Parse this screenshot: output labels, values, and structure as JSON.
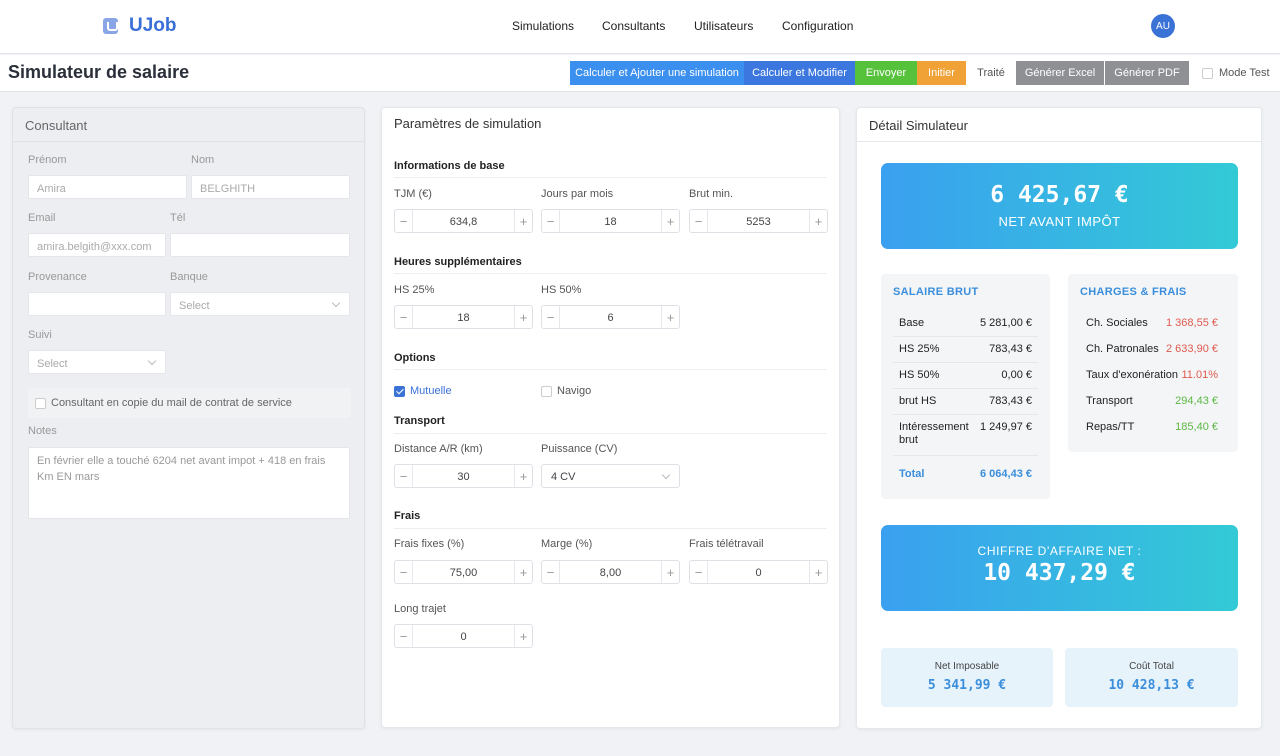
{
  "app": {
    "name": "UJob"
  },
  "nav": {
    "items": [
      "Simulations",
      "Consultants",
      "Utilisateurs",
      "Configuration"
    ],
    "avatar": "AU"
  },
  "page": {
    "title": "Simulateur de salaire"
  },
  "toolbar": {
    "calc_add": "Calculer et Ajouter une simulation",
    "calc_modify": "Calculer et Modifier",
    "envoyer": "Envoyer",
    "initier": "Initier",
    "traite": "Traité",
    "excel": "Générer Excel",
    "pdf": "Générer PDF",
    "mode_test": "Mode Test",
    "colors": {
      "blue": "#3b8fee",
      "blue_dark": "#3c76df",
      "green": "#56c23c",
      "orange": "#f0a236",
      "gray": "#8e9094"
    }
  },
  "consultant": {
    "title": "Consultant",
    "prenom_label": "Prénom",
    "prenom_value": "Amira",
    "nom_label": "Nom",
    "nom_value": "BELGHITH",
    "email_label": "Email",
    "email_value": "amira.belgith@xxx.com",
    "tel_label": "Tél",
    "tel_value": "",
    "provenance_label": "Provenance",
    "provenance_value": "",
    "banque_label": "Banque",
    "banque_value": "Select",
    "suivi_label": "Suivi",
    "suivi_value": "Select",
    "copy_label": "Consultant en copie du mail de contrat de service",
    "notes_label": "Notes",
    "notes_value": "En février elle a touché 6204 net avant impot + 418 en frais Km EN mars"
  },
  "params": {
    "title": "Paramètres de simulation",
    "base": {
      "title": "Informations de base",
      "tjm_label": "TJM (€)",
      "tjm": "634,8",
      "jours_label": "Jours par mois",
      "jours": "18",
      "brut_label": "Brut min.",
      "brut": "5253"
    },
    "hs": {
      "title": "Heures supplémentaires",
      "hs25_label": "HS 25%",
      "hs25": "18",
      "hs50_label": "HS 50%",
      "hs50": "6"
    },
    "options": {
      "title": "Options",
      "mutuelle": "Mutuelle",
      "mutuelle_checked": true,
      "navigo": "Navigo",
      "navigo_checked": false
    },
    "transport": {
      "title": "Transport",
      "distance_label": "Distance A/R (km)",
      "distance": "30",
      "puissance_label": "Puissance (CV)",
      "puissance": "4 CV"
    },
    "frais": {
      "title": "Frais",
      "fixes_label": "Frais fixes (%)",
      "fixes": "75,00",
      "marge_label": "Marge (%)",
      "marge": "8,00",
      "tele_label": "Frais télétravail",
      "tele": "0",
      "long_label": "Long trajet",
      "long": "0"
    },
    "minus": "−",
    "plus": "+"
  },
  "detail": {
    "title": "Détail Simulateur",
    "net_value": "6 425,67 €",
    "net_label": "NET AVANT IMPÔT",
    "brut": {
      "title": "SALAIRE BRUT",
      "rows": [
        {
          "label": "Base",
          "value": "5 281,00 €"
        },
        {
          "label": "HS 25%",
          "value": "783,43 €"
        },
        {
          "label": "HS 50%",
          "value": "0,00 €"
        },
        {
          "label": "brut HS",
          "value": "783,43 €"
        },
        {
          "label": "Intéressement brut",
          "value": "1 249,97 €"
        }
      ],
      "total_label": "Total",
      "total_value": "6 064,43 €"
    },
    "charges": {
      "title": "CHARGES & FRAIS",
      "rows": [
        {
          "label": "Ch. Sociales",
          "value": "1 368,55 €",
          "color": "#e05a4f"
        },
        {
          "label": "Ch. Patronales",
          "value": "2 633,90 €",
          "color": "#e05a4f"
        },
        {
          "label": "Taux d'exonération",
          "value": "11.01%",
          "color": "#e05a4f"
        },
        {
          "label": "Transport",
          "value": "294,43 €",
          "color": "#5cb744"
        },
        {
          "label": "Repas/TT",
          "value": "185,40 €",
          "color": "#5cb744"
        }
      ]
    },
    "ca_label": "CHIFFRE D'AFFAIRE NET :",
    "ca_value": "10 437,29 €",
    "net_imposable_label": "Net Imposable",
    "net_imposable_value": "5 341,99 €",
    "cout_total_label": "Coût Total",
    "cout_total_value": "10 428,13 €"
  }
}
